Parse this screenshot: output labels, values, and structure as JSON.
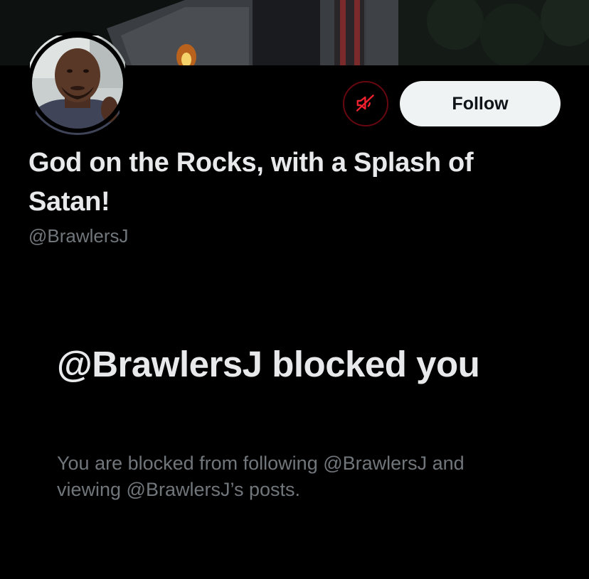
{
  "profile": {
    "display_name": "God on the Rocks, with a Splash of Satan!",
    "handle": "@BrawlersJ"
  },
  "actions": {
    "unmute_icon": "muted-speaker-icon",
    "follow_label": "Follow"
  },
  "block_notice": {
    "title": "@BrawlersJ blocked you",
    "description": "You are blocked from following @BrawlersJ and viewing @BrawlersJ’s posts."
  },
  "colors": {
    "background": "#000000",
    "primary_text": "#e7e9ea",
    "secondary_text": "#71767b",
    "follow_button_bg": "#eff3f4",
    "follow_button_text": "#0f1419",
    "mute_icon": "#f4212e",
    "mute_border": "#67070f"
  }
}
